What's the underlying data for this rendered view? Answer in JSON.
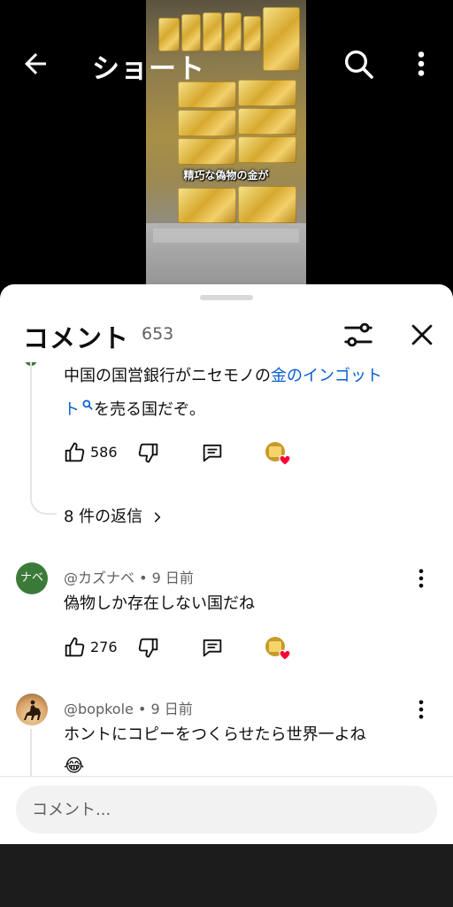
{
  "header": {
    "title": "ショート",
    "back_icon": "arrow-left-icon",
    "search_icon": "search-icon",
    "more_icon": "more-vert-icon"
  },
  "video": {
    "caption": "精巧な偽物の金が"
  },
  "comments_panel": {
    "title": "コメント",
    "count": "653",
    "filter_icon": "tune-icon",
    "close_icon": "close-icon",
    "comments": [
      {
        "text_before": "中国の国営銀行がニセモノの",
        "text_link": "金のインゴット",
        "text_link_2": "ト",
        "text_after": "を売る国だぞ。",
        "likes": "586",
        "replies_label": "8 件の返信"
      },
      {
        "avatar_text": "ナベ",
        "author": "@カズナベ",
        "age": "9 日前",
        "text": "偽物しか存在しない国だね",
        "likes": "276"
      },
      {
        "author": "@bopkole",
        "age": "9 日前",
        "text": "ホントにコピーをつくらせたら世界一よね",
        "emoji": "😂"
      }
    ],
    "input_placeholder": "コメント..."
  },
  "colors": {
    "link": "#065fd4",
    "heart": "#ff0033",
    "secondary_text": "#606060"
  }
}
